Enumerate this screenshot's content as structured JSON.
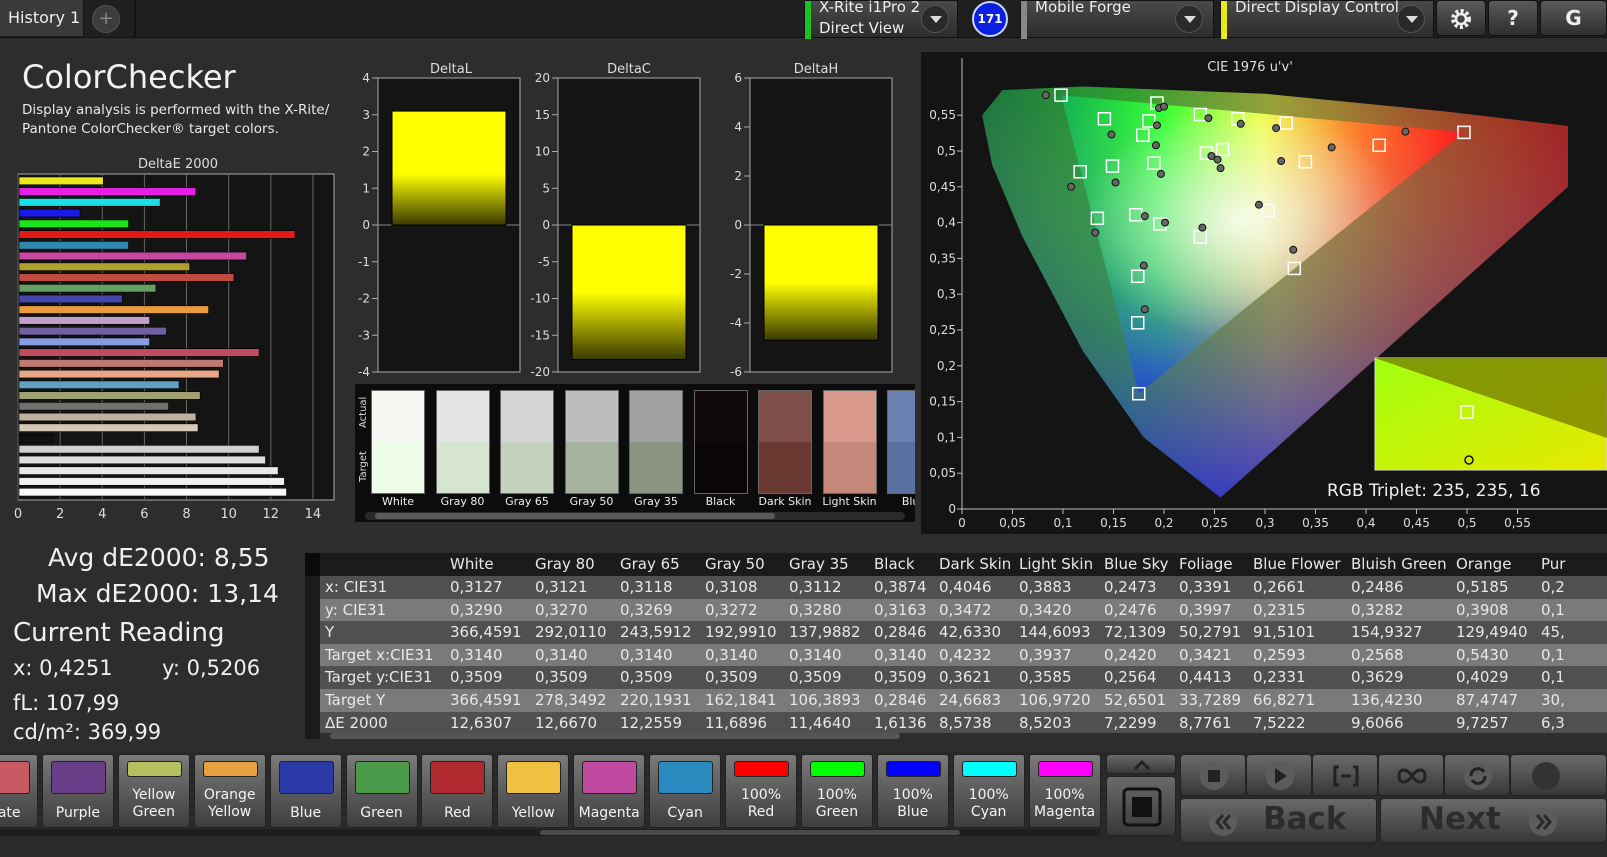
{
  "header": {
    "history_tab": "History 1",
    "add_tab": "+",
    "device1_line1": "X-Rite i1Pro 2",
    "device1_line2": "Direct View",
    "device1_color": "#19c41f",
    "badge": "171",
    "device2": "Mobile Forge",
    "device3": "Direct Display Control",
    "device3_color": "#e8e81a",
    "settings_icon": "gear-icon",
    "help_label": "?",
    "extra_label": "G"
  },
  "left": {
    "title": "ColorChecker",
    "subtitle": "Display analysis is performed with the X-Rite/ Pantone ColorChecker® target colors.",
    "avg": "Avg dE2000: 8,55",
    "max": "Max dE2000: 13,14",
    "current_title": "Current Reading",
    "x": "x: 0,4251",
    "y": "y: 0,5206",
    "fl": "fL: 107,99",
    "cd": "cd/m²: 369,99"
  },
  "chart_data": [
    {
      "type": "bar",
      "title": "DeltaE 2000",
      "orientation": "horizontal",
      "xlim": [
        0,
        15
      ],
      "xticks": [
        "0",
        "2",
        "4",
        "6",
        "8",
        "10",
        "12",
        "14"
      ],
      "values": [
        4.0,
        8.4,
        6.7,
        2.9,
        5.2,
        13.1,
        5.2,
        10.8,
        8.1,
        10.2,
        6.5,
        4.9,
        9.0,
        6.2,
        7.0,
        6.2,
        11.4,
        9.7,
        9.5,
        7.6,
        8.6,
        7.1,
        8.4,
        8.5,
        1.6,
        11.4,
        11.7,
        12.3,
        12.6,
        12.7
      ],
      "colors": [
        "#e8e81a",
        "#e61ee6",
        "#19e0e8",
        "#1a19e6",
        "#19e619",
        "#e61919",
        "#2e8ab0",
        "#c646a0",
        "#b0a030",
        "#c04c40",
        "#64a062",
        "#4548a8",
        "#e89a3c",
        "#c0a0c8",
        "#7060a0",
        "#8a9ce0",
        "#c04c60",
        "#c07870",
        "#e8a888",
        "#60a0c0",
        "#a0a070",
        "#707070",
        "#c0b0a0",
        "#d8c8b8",
        "#101010",
        "#d0d0d0",
        "#e0e0e0",
        "#e8e8e8",
        "#f0f0f0",
        "#f8f8f8"
      ]
    },
    {
      "type": "bar",
      "title": "DeltaL",
      "ylim": [
        -4,
        4
      ],
      "yticks": [
        "4",
        "3",
        "2",
        "1",
        "0",
        "-1",
        "-2",
        "-3",
        "-4"
      ],
      "values": [
        3.1
      ],
      "color": "#ffff00"
    },
    {
      "type": "bar",
      "title": "DeltaC",
      "ylim": [
        -20,
        20
      ],
      "yticks": [
        "20",
        "15",
        "10",
        "5",
        "0",
        "-5",
        "-10",
        "-15",
        "-20"
      ],
      "values": [
        -18.3
      ],
      "color": "#ffff00"
    },
    {
      "type": "bar",
      "title": "DeltaH",
      "ylim": [
        -6,
        6
      ],
      "yticks": [
        "6",
        "4",
        "2",
        "0",
        "-2",
        "-4",
        "-6"
      ],
      "values": [
        -4.7
      ],
      "color": "#ffff00"
    },
    {
      "type": "scatter",
      "title": "CIE 1976 u'v'",
      "xlim": [
        0,
        0.6
      ],
      "ylim": [
        0,
        0.6
      ],
      "xticks": [
        "0",
        "0,05",
        "0,1",
        "0,15",
        "0,2",
        "0,25",
        "0,3",
        "0,35",
        "0,4",
        "0,45",
        "0,5",
        "0,55"
      ],
      "yticks": [
        "0,55",
        "0,5",
        "0,45",
        "0,4",
        "0,35",
        "0,3",
        "0,25",
        "0,2",
        "0,15",
        "0,1",
        "0,05",
        "0"
      ],
      "targets": [
        [
          0.098,
          0.578
        ],
        [
          0.193,
          0.567
        ],
        [
          0.141,
          0.545
        ],
        [
          0.185,
          0.542
        ],
        [
          0.179,
          0.522
        ],
        [
          0.236,
          0.551
        ],
        [
          0.273,
          0.545
        ],
        [
          0.321,
          0.539
        ],
        [
          0.117,
          0.471
        ],
        [
          0.149,
          0.479
        ],
        [
          0.19,
          0.483
        ],
        [
          0.242,
          0.497
        ],
        [
          0.258,
          0.502
        ],
        [
          0.34,
          0.485
        ],
        [
          0.413,
          0.508
        ],
        [
          0.497,
          0.526
        ],
        [
          0.134,
          0.406
        ],
        [
          0.172,
          0.411
        ],
        [
          0.196,
          0.398
        ],
        [
          0.236,
          0.38
        ],
        [
          0.303,
          0.417
        ],
        [
          0.329,
          0.336
        ],
        [
          0.174,
          0.325
        ],
        [
          0.174,
          0.26
        ],
        [
          0.175,
          0.161
        ]
      ],
      "measured": [
        [
          0.083,
          0.578
        ],
        [
          0.195,
          0.56
        ],
        [
          0.2,
          0.562
        ],
        [
          0.148,
          0.523
        ],
        [
          0.193,
          0.536
        ],
        [
          0.244,
          0.546
        ],
        [
          0.276,
          0.538
        ],
        [
          0.311,
          0.532
        ],
        [
          0.108,
          0.45
        ],
        [
          0.152,
          0.456
        ],
        [
          0.192,
          0.508
        ],
        [
          0.247,
          0.493
        ],
        [
          0.253,
          0.488
        ],
        [
          0.316,
          0.486
        ],
        [
          0.366,
          0.505
        ],
        [
          0.439,
          0.527
        ],
        [
          0.132,
          0.386
        ],
        [
          0.181,
          0.409
        ],
        [
          0.201,
          0.4
        ],
        [
          0.238,
          0.393
        ],
        [
          0.294,
          0.425
        ],
        [
          0.328,
          0.362
        ],
        [
          0.18,
          0.34
        ],
        [
          0.181,
          0.279
        ],
        [
          0.256,
          0.476
        ],
        [
          0.197,
          0.468
        ]
      ],
      "annotation": "RGB Triplet: 235, 235, 16"
    }
  ],
  "swatches": [
    {
      "label": "White",
      "actual": "#f4f7f1",
      "target": "#eefde9"
    },
    {
      "label": "Gray 80",
      "actual": "#e4e4e4",
      "target": "#d6e4d2"
    },
    {
      "label": "Gray 65",
      "actual": "#d5d5d5",
      "target": "#c6d2c0"
    },
    {
      "label": "Gray 50",
      "actual": "#bdbdbd",
      "target": "#a8b2a0"
    },
    {
      "label": "Gray 35",
      "actual": "#a1a1a1",
      "target": "#8a9480"
    },
    {
      "label": "Black",
      "actual": "#0f0909",
      "target": "#0a0606"
    },
    {
      "label": "Dark Skin",
      "actual": "#7e4f48",
      "target": "#6a3a32"
    },
    {
      "label": "Light Skin",
      "actual": "#d8988a",
      "target": "#c4887a"
    },
    {
      "label": "Blue",
      "actual": "#6a80b0",
      "target": "#5a70a0"
    }
  ],
  "swatch_axis": {
    "actual": "Actual",
    "target": "Target"
  },
  "table": {
    "columns": [
      "White",
      "Gray 80",
      "Gray 65",
      "Gray 50",
      "Gray 35",
      "Black",
      "Dark Skin",
      "Light Skin",
      "Blue Sky",
      "Foliage",
      "Blue Flower",
      "Bluish Green",
      "Orange",
      "Pur"
    ],
    "rows": [
      {
        "label": "x: CIE31",
        "values": [
          "0,3127",
          "0,3121",
          "0,3118",
          "0,3108",
          "0,3112",
          "0,3874",
          "0,4046",
          "0,3883",
          "0,2473",
          "0,3391",
          "0,2661",
          "0,2486",
          "0,5185",
          "0,2"
        ]
      },
      {
        "label": "y: CIE31",
        "values": [
          "0,3290",
          "0,3270",
          "0,3269",
          "0,3272",
          "0,3280",
          "0,3163",
          "0,3472",
          "0,3420",
          "0,2476",
          "0,3997",
          "0,2315",
          "0,3282",
          "0,3908",
          "0,1"
        ]
      },
      {
        "label": "Y",
        "values": [
          "366,4591",
          "292,0110",
          "243,5912",
          "192,9910",
          "137,9882",
          "0,2846",
          "42,6330",
          "144,6093",
          "72,1309",
          "50,2791",
          "91,5101",
          "154,9327",
          "129,4940",
          "45,"
        ]
      },
      {
        "label": "Target x:CIE31",
        "values": [
          "0,3140",
          "0,3140",
          "0,3140",
          "0,3140",
          "0,3140",
          "0,3140",
          "0,4232",
          "0,3937",
          "0,2420",
          "0,3421",
          "0,2593",
          "0,2568",
          "0,5430",
          "0,1"
        ]
      },
      {
        "label": "Target y:CIE31",
        "values": [
          "0,3509",
          "0,3509",
          "0,3509",
          "0,3509",
          "0,3509",
          "0,3509",
          "0,3621",
          "0,3585",
          "0,2564",
          "0,4413",
          "0,2331",
          "0,3629",
          "0,4029",
          "0,1"
        ]
      },
      {
        "label": "Target Y",
        "values": [
          "366,4591",
          "278,3492",
          "220,1931",
          "162,1841",
          "106,3893",
          "0,2846",
          "24,6683",
          "106,9720",
          "52,6501",
          "33,7289",
          "66,8271",
          "136,4230",
          "87,4747",
          "30,"
        ]
      },
      {
        "label": "ΔE 2000",
        "values": [
          "12,6307",
          "12,6670",
          "12,2559",
          "11,6896",
          "11,4640",
          "1,6136",
          "8,5738",
          "8,5203",
          "7,2299",
          "8,7761",
          "7,5222",
          "9,6066",
          "9,7257",
          "6,3"
        ]
      }
    ]
  },
  "patches": [
    {
      "label": "erate",
      "color": "#c85a64"
    },
    {
      "label": "Purple",
      "color": "#6a3f8a"
    },
    {
      "label": "Yellow Green",
      "color": "#b5c060"
    },
    {
      "label": "Orange Yellow",
      "color": "#e8a040"
    },
    {
      "label": "Blue",
      "color": "#2a3aa8"
    },
    {
      "label": "Green",
      "color": "#4a9a4a"
    },
    {
      "label": "Red",
      "color": "#b02a30"
    },
    {
      "label": "Yellow",
      "color": "#f0c040"
    },
    {
      "label": "Magenta",
      "color": "#c04aa0"
    },
    {
      "label": "Cyan",
      "color": "#2a8ac0"
    },
    {
      "label": "100% Red",
      "color": "#ff0000"
    },
    {
      "label": "100% Green",
      "color": "#00ff00"
    },
    {
      "label": "100% Blue",
      "color": "#0000ff"
    },
    {
      "label": "100% Cyan",
      "color": "#00ffff"
    },
    {
      "label": "100% Magenta",
      "color": "#ff00ff"
    }
  ],
  "controls": {
    "back": "Back",
    "next": "Next"
  }
}
